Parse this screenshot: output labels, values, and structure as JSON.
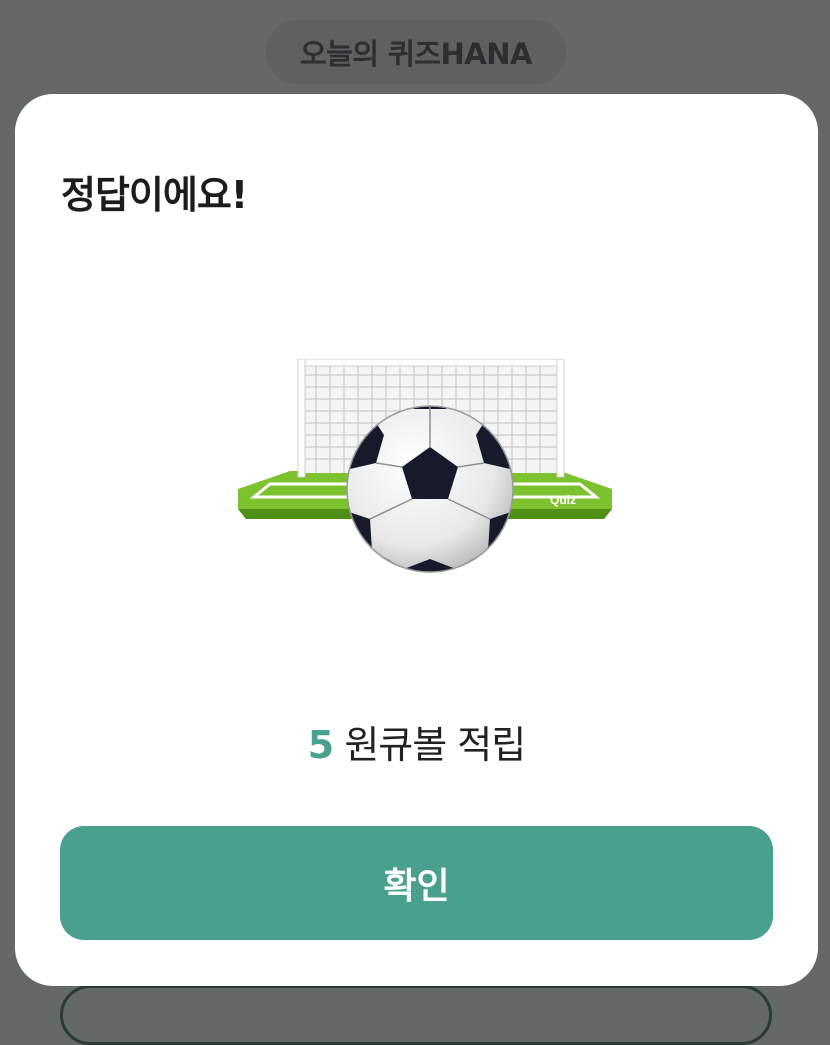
{
  "header": {
    "title": "오늘의 퀴즈HANA"
  },
  "modal": {
    "title": "정답이에요!",
    "illustration": {
      "icon": "soccer-goal-ball-icon",
      "badge_text": "Quiz"
    },
    "reward": {
      "amount": "5",
      "text": "원큐볼 적립"
    },
    "confirm_label": "확인"
  },
  "colors": {
    "accent": "#4aa08e",
    "overlay": "#646867",
    "modal_bg": "#ffffff"
  }
}
